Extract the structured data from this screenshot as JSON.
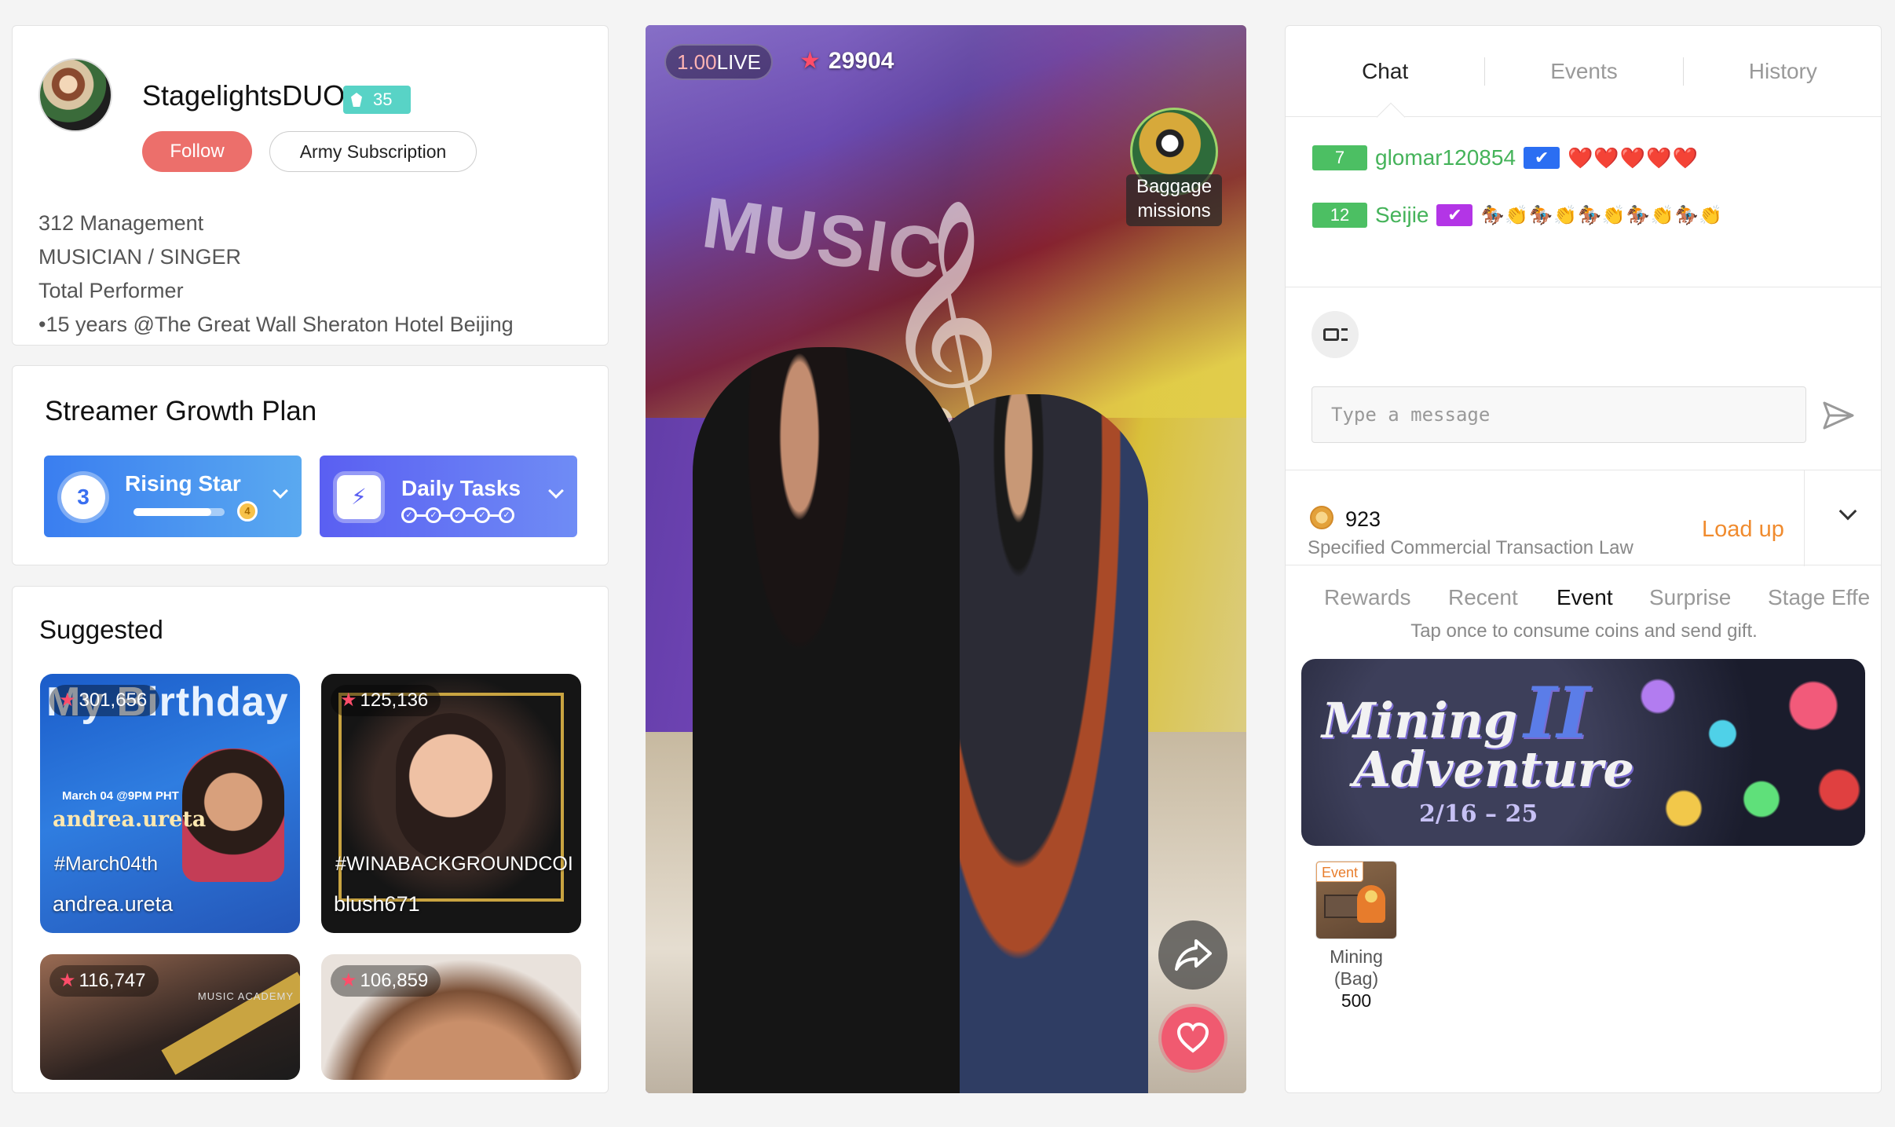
{
  "profile": {
    "name": "StagelightsDUO",
    "level": "35",
    "follow_label": "Follow",
    "army_label": "Army Subscription",
    "bio": [
      "312 Management",
      "MUSICIAN / SINGER",
      "Total Performer",
      "•15 years @The Great Wall Sheraton Hotel Beijing"
    ]
  },
  "growth": {
    "title": "Streamer Growth Plan",
    "rising_star": {
      "label": "Rising Star",
      "level": "3",
      "next_level": "4",
      "progress": 0.85
    },
    "daily_tasks": {
      "label": "Daily Tasks",
      "completed": 5,
      "total": 5
    }
  },
  "suggested": {
    "title": "Suggested",
    "items": [
      {
        "views": "301,656",
        "hashtag": "#March04th",
        "name": "andrea.ureta",
        "overlay_title": "My Birthday",
        "overlay_date": "March 04 @9PM PHT",
        "overlay_script": "andrea.ureta"
      },
      {
        "views": "125,136",
        "hashtag": "#WINABACKGROUNDCOI",
        "name": "blush671"
      },
      {
        "views": "116,747",
        "overlay_text": "MUSIC ACADEMY"
      },
      {
        "views": "106,859"
      }
    ]
  },
  "video": {
    "live_rate": "1.00",
    "live_text": "LIVE",
    "viewers": "29904",
    "baggage_label": "Baggage missions",
    "wall_text": "MUSIC",
    "clef": "𝄞"
  },
  "chat": {
    "tabs": [
      "Chat",
      "Events",
      "History"
    ],
    "active_tab": "Chat",
    "messages": [
      {
        "level": "7",
        "user": "glomar120854",
        "badge_color": "#2b6ef2",
        "content": "❤️❤️❤️❤️❤️"
      },
      {
        "level": "12",
        "user": "Seijie",
        "badge_color": "#b335e6",
        "content": "🏇👏🏇👏🏇👏🏇👏🏇👏"
      }
    ],
    "input_placeholder": "Type a message",
    "coins": "923",
    "law_link": "Specified Commercial Transaction Law",
    "load_up": "Load up",
    "gift_tabs": [
      "Rewards",
      "Recent",
      "Event",
      "Surprise",
      "Stage Effe"
    ],
    "active_gift_tab": "Event",
    "hint": "Tap once to consume coins and send gift.",
    "banner": {
      "title_line1": "Mining",
      "title_line2": "Adventure",
      "roman": "II",
      "dates": "2/16 – 25"
    },
    "gift": {
      "tag": "Event",
      "name": "Mining (Bag)",
      "price": "500"
    }
  },
  "colors": {
    "follow": "#ec6f6b",
    "level_badge": "#58d3c6",
    "user_level": "#4cbf63",
    "load_up": "#f08b2e",
    "like": "#f05a70"
  }
}
